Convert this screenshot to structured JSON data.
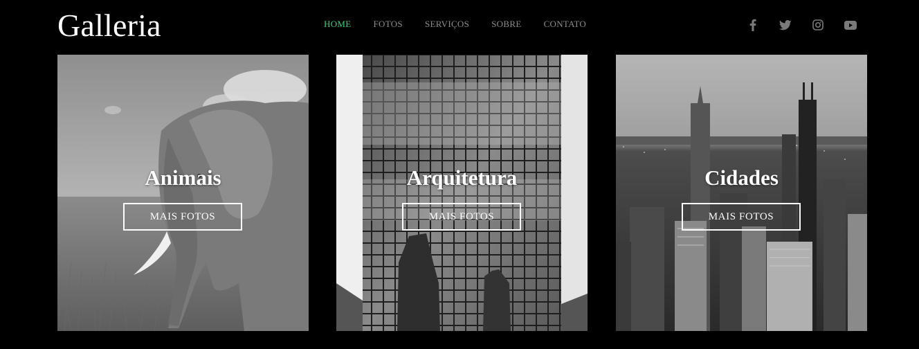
{
  "brand": {
    "logo": "Galleria"
  },
  "nav": {
    "items": [
      {
        "label": "HOME",
        "active": true
      },
      {
        "label": "FOTOS",
        "active": false
      },
      {
        "label": "SERVIÇOS",
        "active": false
      },
      {
        "label": "SOBRE",
        "active": false
      },
      {
        "label": "CONTATO",
        "active": false
      }
    ]
  },
  "social": {
    "icons": [
      "facebook-icon",
      "twitter-icon",
      "instagram-icon",
      "youtube-icon"
    ]
  },
  "gallery": {
    "cards": [
      {
        "title": "Animais",
        "button": "MAIS FOTOS",
        "image": "elephant-photo"
      },
      {
        "title": "Arquitetura",
        "button": "MAIS FOTOS",
        "image": "glass-skyscraper-photo"
      },
      {
        "title": "Cidades",
        "button": "MAIS FOTOS",
        "image": "city-skyline-photo"
      }
    ]
  },
  "colors": {
    "background": "#000000",
    "accent": "#3ad07a",
    "nav_text": "#8c8c8c",
    "social_icon": "#7a7a7a"
  }
}
